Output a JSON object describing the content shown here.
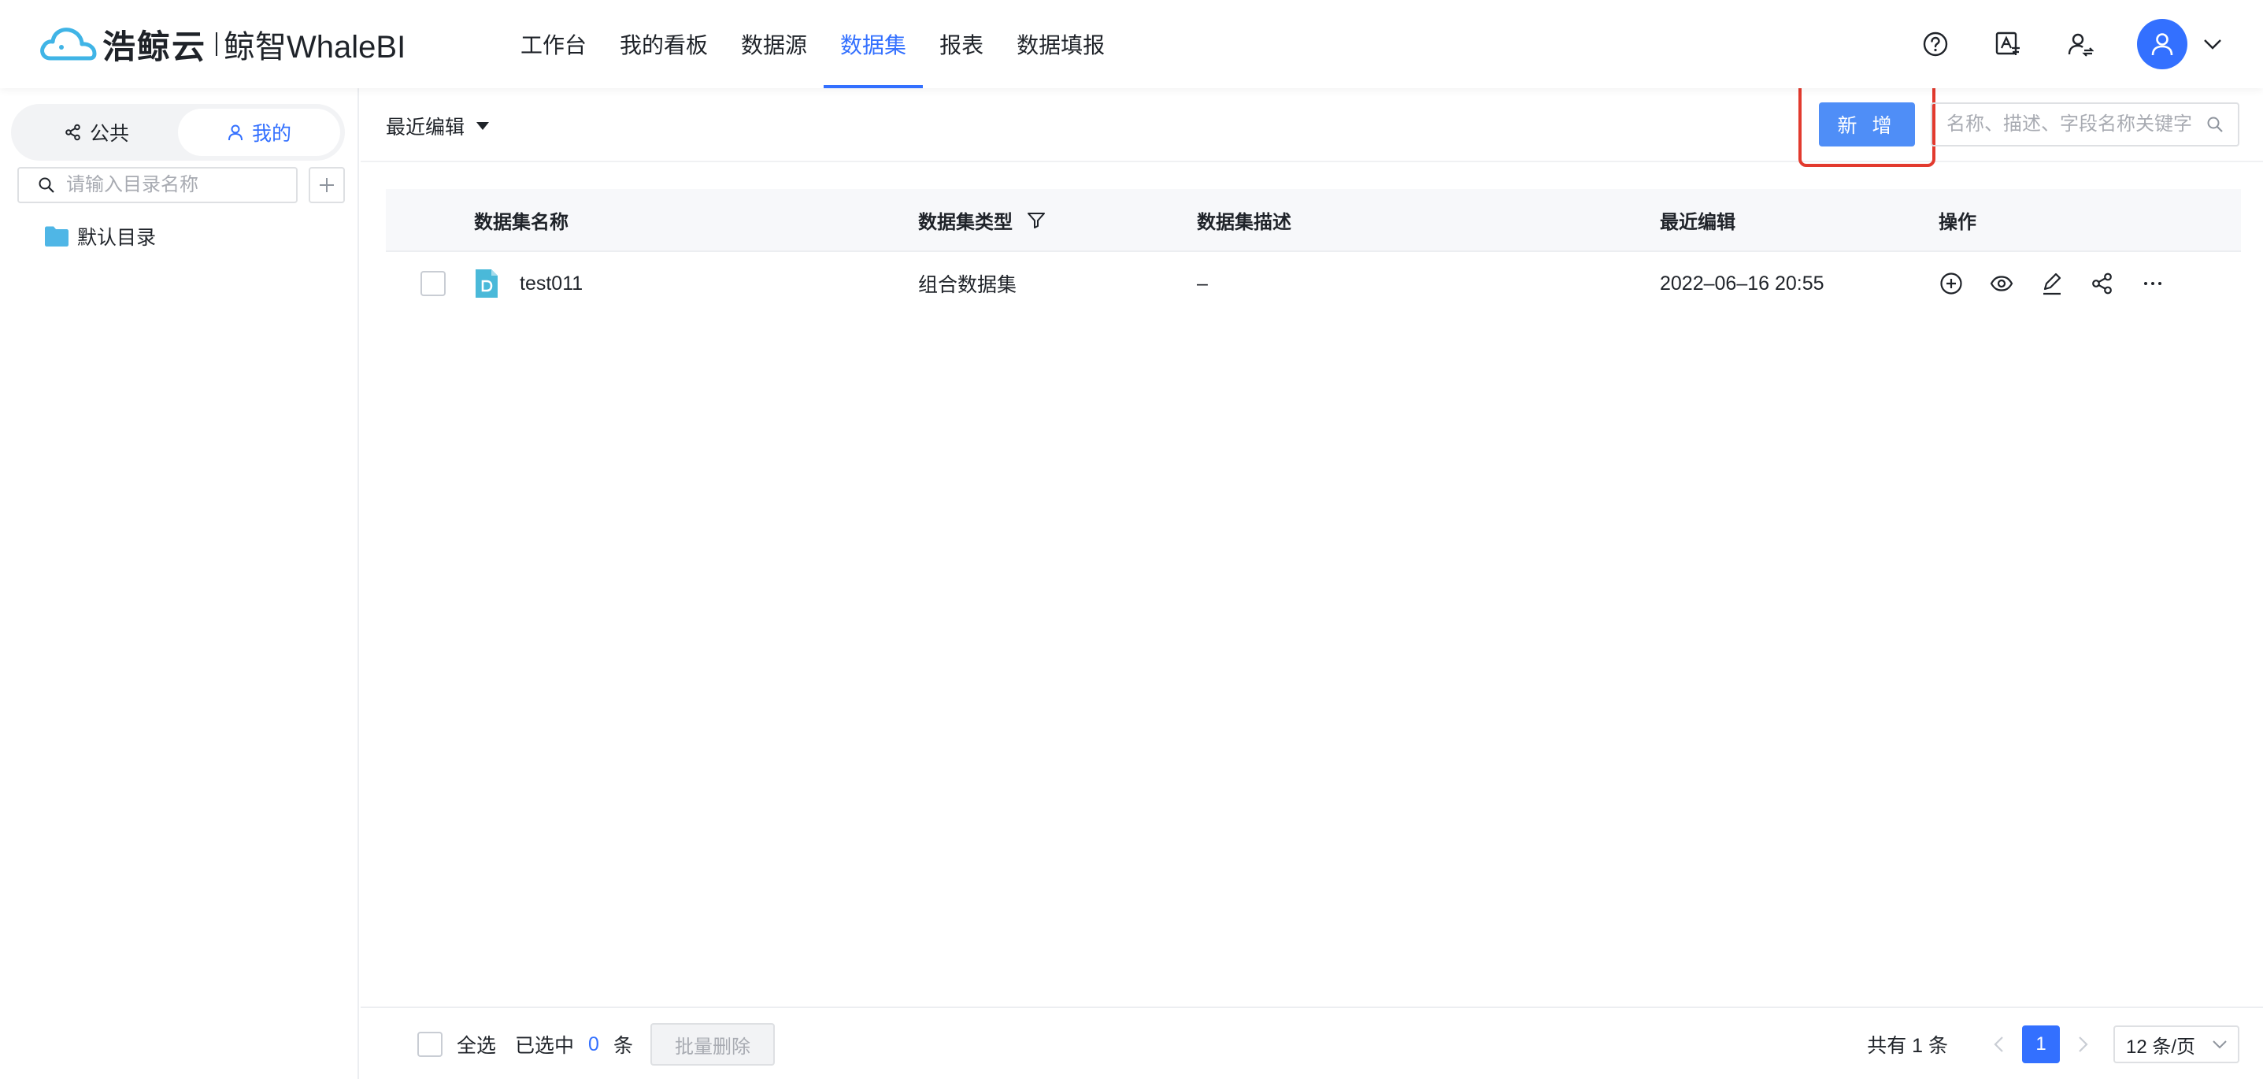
{
  "brand": {
    "name_cn": "浩鲸云",
    "product": "鲸智WhaleBI"
  },
  "nav": [
    {
      "label": "工作台"
    },
    {
      "label": "我的看板"
    },
    {
      "label": "数据源"
    },
    {
      "label": "数据集",
      "active": true
    },
    {
      "label": "报表"
    },
    {
      "label": "数据填报"
    }
  ],
  "header_icons": [
    "help-circle-icon",
    "translate-icon",
    "user-switch-icon",
    "user-avatar-icon",
    "chevron-down-icon"
  ],
  "sidebar": {
    "tabs": [
      {
        "label": "公共"
      },
      {
        "label": "我的",
        "active": true
      }
    ],
    "search_placeholder": "请输入目录名称",
    "tree": [
      {
        "label": "默认目录"
      }
    ]
  },
  "toolbar": {
    "sort_label": "最近编辑",
    "add_label": "新 增",
    "search_placeholder": "名称、描述、字段名称关键字"
  },
  "table": {
    "columns": [
      "数据集名称",
      "数据集类型",
      "数据集描述",
      "最近编辑",
      "操作"
    ],
    "rows": [
      {
        "name": "test011",
        "type": "组合数据集",
        "desc": "–",
        "edited": "2022–06–16 20:55"
      }
    ],
    "row_actions": [
      "add-circle-icon",
      "eye-icon",
      "edit-icon",
      "share-icon",
      "more-icon"
    ]
  },
  "footer": {
    "select_all": "全选",
    "selected_prefix": "已选中",
    "selected_count": "0",
    "selected_suffix": "条",
    "batch_delete": "批量删除",
    "total": "共有 1 条",
    "current_page": "1",
    "page_size": "12 条/页"
  },
  "colors": {
    "accent": "#3370ff",
    "add_button": "#4f8ef7",
    "highlight": "#e23a2e",
    "folder": "#4fb6e6",
    "file_icon": "#4ab9d9"
  }
}
